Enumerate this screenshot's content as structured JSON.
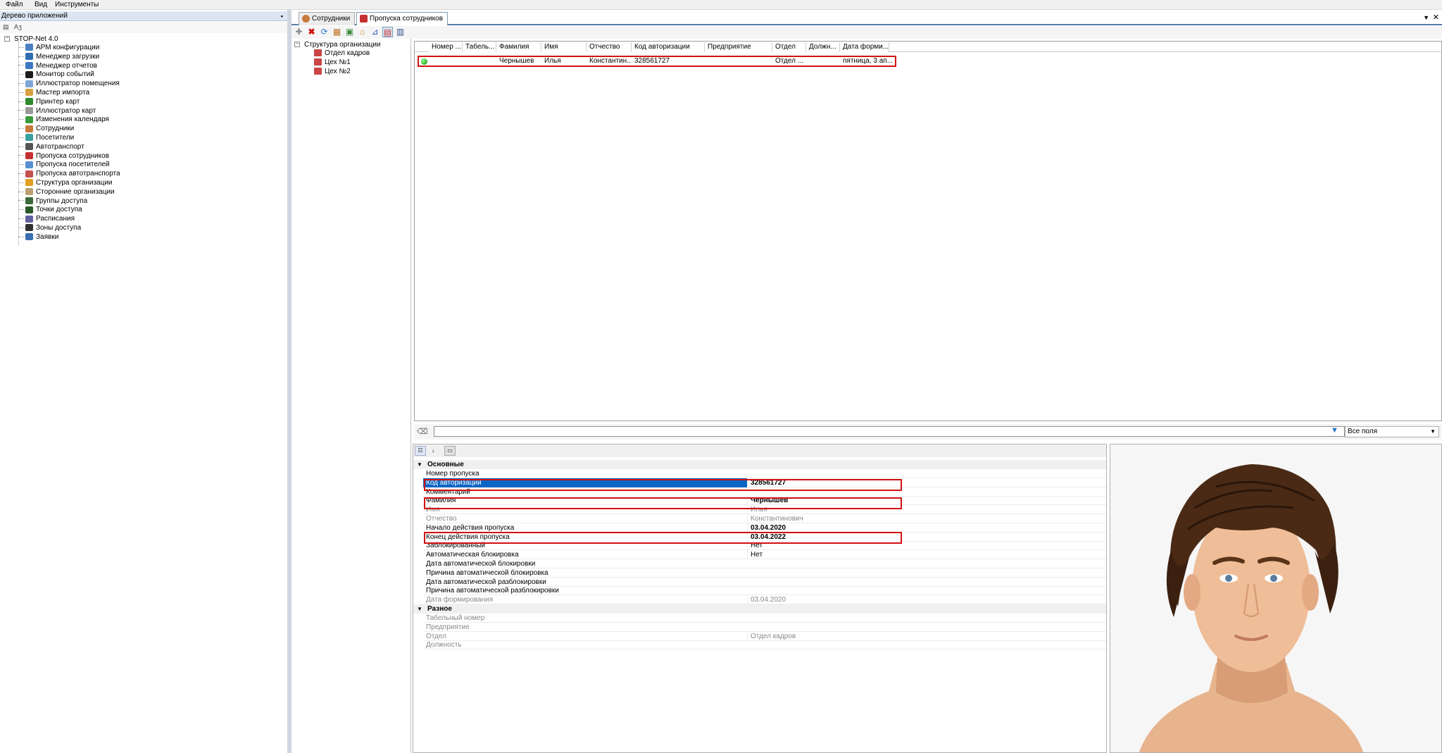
{
  "menu": [
    "Файл",
    "Вид",
    "Инструменты"
  ],
  "left_panel": {
    "title": "Дерево приложений",
    "toolbar_text": "Aʒ",
    "root": "STOP-Net 4.0",
    "items": [
      {
        "label": "АРМ конфигурации",
        "icon": "config-icon",
        "color": "#4a7fc1"
      },
      {
        "label": "Менеджер загрузки",
        "icon": "download-icon",
        "color": "#2f6db5"
      },
      {
        "label": "Менеджер отчетов",
        "icon": "report-icon",
        "color": "#3c78c4"
      },
      {
        "label": "Монитор событий",
        "icon": "monitor-icon",
        "color": "#1c1c1c"
      },
      {
        "label": "Иллюстратор помещения",
        "icon": "room-icon",
        "color": "#7fa6d6"
      },
      {
        "label": "Мастер импорта",
        "icon": "import-icon",
        "color": "#d8a040"
      },
      {
        "label": "Принтер карт",
        "icon": "printer-icon",
        "color": "#2c8b2c"
      },
      {
        "label": "Иллюстратор карт",
        "icon": "card-icon",
        "color": "#999999"
      },
      {
        "label": "Изменения календаря",
        "icon": "calendar-icon",
        "color": "#3a9a3a"
      },
      {
        "label": "Сотрудники",
        "icon": "employees-icon",
        "color": "#c8783a"
      },
      {
        "label": "Посетители",
        "icon": "visitors-icon",
        "color": "#3aa0a0"
      },
      {
        "label": "Автотранспорт",
        "icon": "car-icon",
        "color": "#555555"
      },
      {
        "label": "Пропуска сотрудников",
        "icon": "employee-pass-icon",
        "color": "#c43030"
      },
      {
        "label": "Пропуска посетителей",
        "icon": "visitor-pass-icon",
        "color": "#5a8fd0"
      },
      {
        "label": "Пропуска автотранспорта",
        "icon": "vehicle-pass-icon",
        "color": "#c45050"
      },
      {
        "label": "Структура организации",
        "icon": "structure-icon",
        "color": "#e0a020"
      },
      {
        "label": "Сторонние организации",
        "icon": "external-org-icon",
        "color": "#b8a070"
      },
      {
        "label": "Группы доступа",
        "icon": "access-group-icon",
        "color": "#3a6a3a"
      },
      {
        "label": "Точки доступа",
        "icon": "access-point-icon",
        "color": "#2a5a2a"
      },
      {
        "label": "Расписания",
        "icon": "schedule-icon",
        "color": "#6060a0"
      },
      {
        "label": "Зоны доступа",
        "icon": "zone-icon",
        "color": "#303030"
      },
      {
        "label": "Заявки",
        "icon": "request-icon",
        "color": "#3a6fb0"
      }
    ]
  },
  "tabs": [
    {
      "label": "Сотрудники",
      "active": false
    },
    {
      "label": "Пропуска сотрудников",
      "active": true
    }
  ],
  "org_tree": {
    "root": "Структура организации",
    "items": [
      "Отдел кадров",
      "Цех №1",
      "Цех №2"
    ]
  },
  "grid": {
    "columns": [
      "Номер ...",
      "Табель...",
      "Фамилия",
      "Имя",
      "Отчество",
      "Код авторизации",
      "Предприятие",
      "Отдел",
      "Должн...",
      "Дата форми..."
    ],
    "row": [
      "",
      "",
      "Чернышев",
      "Илья",
      "Константин...",
      "328561727",
      "",
      "Отдел ...",
      "",
      "пятница, 3 ап..."
    ]
  },
  "filter": {
    "value": "",
    "field": "Все поля"
  },
  "props": {
    "cat_main": "Основные",
    "cat_misc": "Разное",
    "main": [
      {
        "name": "Номер пропуска",
        "value": ""
      },
      {
        "name": "Код авторизации",
        "value": "328561727"
      },
      {
        "name": "Комментарий",
        "value": ""
      },
      {
        "name": "Фамилия",
        "value": "Чернышев"
      },
      {
        "name": "Имя",
        "value": "Илья"
      },
      {
        "name": "Отчество",
        "value": "Константинович"
      },
      {
        "name": "Начало действия пропуска",
        "value": "03.04.2020"
      },
      {
        "name": "Конец действия пропуска",
        "value": "03.04.2022"
      },
      {
        "name": "Заблокированный",
        "value": "Нет"
      },
      {
        "name": "Автоматическая блокировка",
        "value": "Нет"
      },
      {
        "name": "Дата автоматической блокировки",
        "value": ""
      },
      {
        "name": "Причина автоматической блокировка",
        "value": ""
      },
      {
        "name": "Дата автоматической разблокировки",
        "value": ""
      },
      {
        "name": "Причина автоматической разблокировки",
        "value": ""
      },
      {
        "name": "Дата формирования",
        "value": "03.04.2020"
      }
    ],
    "misc": [
      {
        "name": "Табельный номер",
        "value": ""
      },
      {
        "name": "Предприятие",
        "value": ""
      },
      {
        "name": "Отдел",
        "value": "Отдел кадров"
      },
      {
        "name": "Должность",
        "value": ""
      }
    ]
  },
  "colors": {
    "highlight": "#d31010",
    "selection": "#0a66c4"
  }
}
